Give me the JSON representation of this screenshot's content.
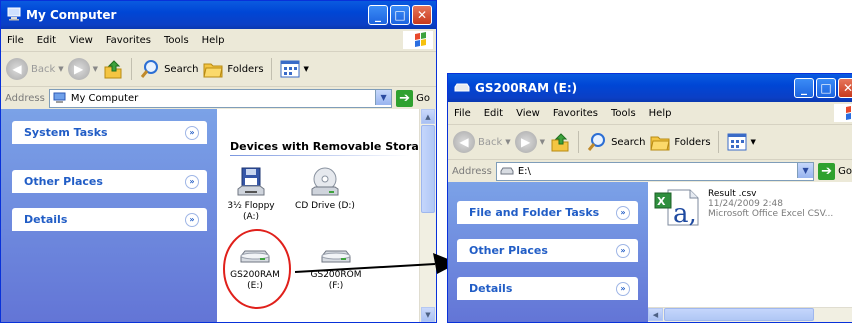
{
  "window1": {
    "title": "My Computer",
    "menu": [
      "File",
      "Edit",
      "View",
      "Favorites",
      "Tools",
      "Help"
    ],
    "toolbar": {
      "back": "Back",
      "search": "Search",
      "folders": "Folders"
    },
    "address": {
      "label": "Address",
      "value": "My Computer",
      "go": "Go"
    },
    "tasks": [
      "System Tasks",
      "Other Places",
      "Details"
    ],
    "group_header": "Devices with Removable Storage",
    "drives": [
      {
        "label": "3½ Floppy",
        "sub": "(A:)",
        "icon": "floppy-drive-icon"
      },
      {
        "label": "CD Drive (D:)",
        "sub": "",
        "icon": "cd-drive-icon"
      },
      {
        "label": "GS200RAM",
        "sub": "(E:)",
        "icon": "removable-drive-icon"
      },
      {
        "label": "GS200ROM",
        "sub": "(F:)",
        "icon": "removable-drive-icon"
      }
    ]
  },
  "window2": {
    "title": "GS200RAM (E:)",
    "menu": [
      "File",
      "Edit",
      "View",
      "Favorites",
      "Tools",
      "Help"
    ],
    "toolbar": {
      "back": "Back",
      "search": "Search",
      "folders": "Folders"
    },
    "address": {
      "label": "Address",
      "value": "E:\\",
      "go": "Go"
    },
    "tasks": [
      "File and Folder Tasks",
      "Other Places",
      "Details"
    ],
    "file": {
      "name": "Result .csv",
      "date": "11/24/2009 2:48",
      "type": "Microsoft Office Excel CSV..."
    }
  },
  "colors": {
    "titlebar": "#0a5be0",
    "highlight_circle": "#e0201b",
    "task_link": "#215dc6"
  }
}
